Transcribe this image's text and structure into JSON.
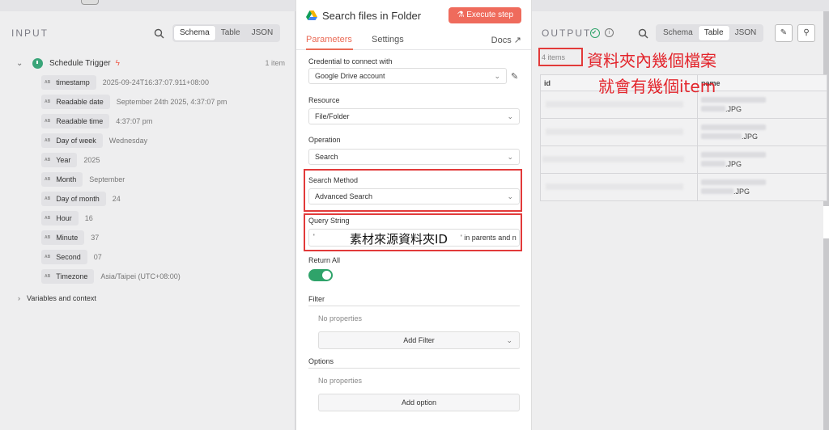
{
  "input_panel": {
    "label": "INPUT",
    "view_modes": [
      "Schema",
      "Table",
      "JSON"
    ],
    "active_view": "Schema",
    "trigger": {
      "name": "Schedule Trigger",
      "count": "1 item"
    },
    "fields": [
      {
        "key": "timestamp",
        "value": "2025-09-24T16:37:07.911+08:00"
      },
      {
        "key": "Readable date",
        "value": "September 24th 2025, 4:37:07 pm"
      },
      {
        "key": "Readable time",
        "value": "4:37:07 pm"
      },
      {
        "key": "Day of week",
        "value": "Wednesday"
      },
      {
        "key": "Year",
        "value": "2025"
      },
      {
        "key": "Month",
        "value": "September"
      },
      {
        "key": "Day of month",
        "value": "24"
      },
      {
        "key": "Hour",
        "value": "16"
      },
      {
        "key": "Minute",
        "value": "37"
      },
      {
        "key": "Second",
        "value": "07"
      },
      {
        "key": "Timezone",
        "value": "Asia/Taipei (UTC+08:00)"
      }
    ],
    "type_badge": "AB",
    "variables_label": "Variables and context"
  },
  "node": {
    "title": "Search files in Folder",
    "execute_label": "Execute step",
    "tabs": [
      "Parameters",
      "Settings"
    ],
    "active_tab": "Parameters",
    "docs_label": "Docs",
    "credential": {
      "label": "Credential to connect with",
      "value": "Google Drive account"
    },
    "resource": {
      "label": "Resource",
      "value": "File/Folder"
    },
    "operation": {
      "label": "Operation",
      "value": "Search"
    },
    "search_method": {
      "label": "Search Method",
      "value": "Advanced Search"
    },
    "query": {
      "label": "Query String",
      "prefix": "'",
      "annotation": "素材來源資料夾ID",
      "suffix": "' in parents and n"
    },
    "return_all": {
      "label": "Return All",
      "enabled": true
    },
    "filter": {
      "label": "Filter",
      "empty": "No properties",
      "button": "Add Filter"
    },
    "options": {
      "label": "Options",
      "empty": "No properties",
      "button": "Add option"
    }
  },
  "output_panel": {
    "label": "OUTPUT",
    "view_modes": [
      "Schema",
      "Table",
      "JSON"
    ],
    "active_view": "Table",
    "items_count": "4 items",
    "annotation_line1": "資料夾內幾個檔案",
    "annotation_line2": "就會有幾個item",
    "columns": [
      "id",
      "name"
    ],
    "rows": [
      {
        "name_visible": ".JPG"
      },
      {
        "name_visible": ".JPG"
      },
      {
        "name_visible": ".JPG"
      },
      {
        "name_visible": ".JPG"
      }
    ]
  },
  "colors": {
    "accent": "#ea6a55",
    "execute_button": "#ef6b5c",
    "toggle_on": "#2fa36a",
    "annotation_red": "#e3232a"
  }
}
